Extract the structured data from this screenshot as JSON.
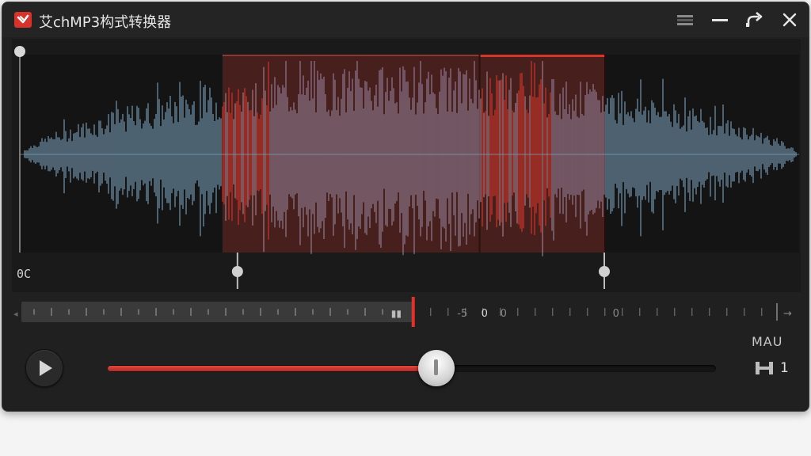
{
  "window": {
    "title": "艾chMP3构式转换器",
    "controls": {
      "menu": "menu-icon",
      "minimize": "minimize-icon",
      "share": "share-icon",
      "close": "close-icon"
    }
  },
  "waveform": {
    "time_start_label": "0C",
    "selection": {
      "start_fraction": 0.26,
      "end_fraction": 0.75,
      "split_fraction": 0.59
    },
    "colors": {
      "wave": "#7ea4bf",
      "wave_selected": "#e43a2f",
      "selection_fill": "#4a201c",
      "selection_border": "#d8352b"
    }
  },
  "timeline": {
    "labels": [
      "-5",
      "0",
      "0",
      "0"
    ],
    "playhead_fraction": 0.51,
    "colors": {
      "playhead": "#e0322a"
    }
  },
  "playback": {
    "play_icon": "play-icon",
    "progress_fraction": 0.54
  },
  "side": {
    "mode_label": "MAU",
    "count_icon": "bracket-icon",
    "count_value": "1"
  }
}
